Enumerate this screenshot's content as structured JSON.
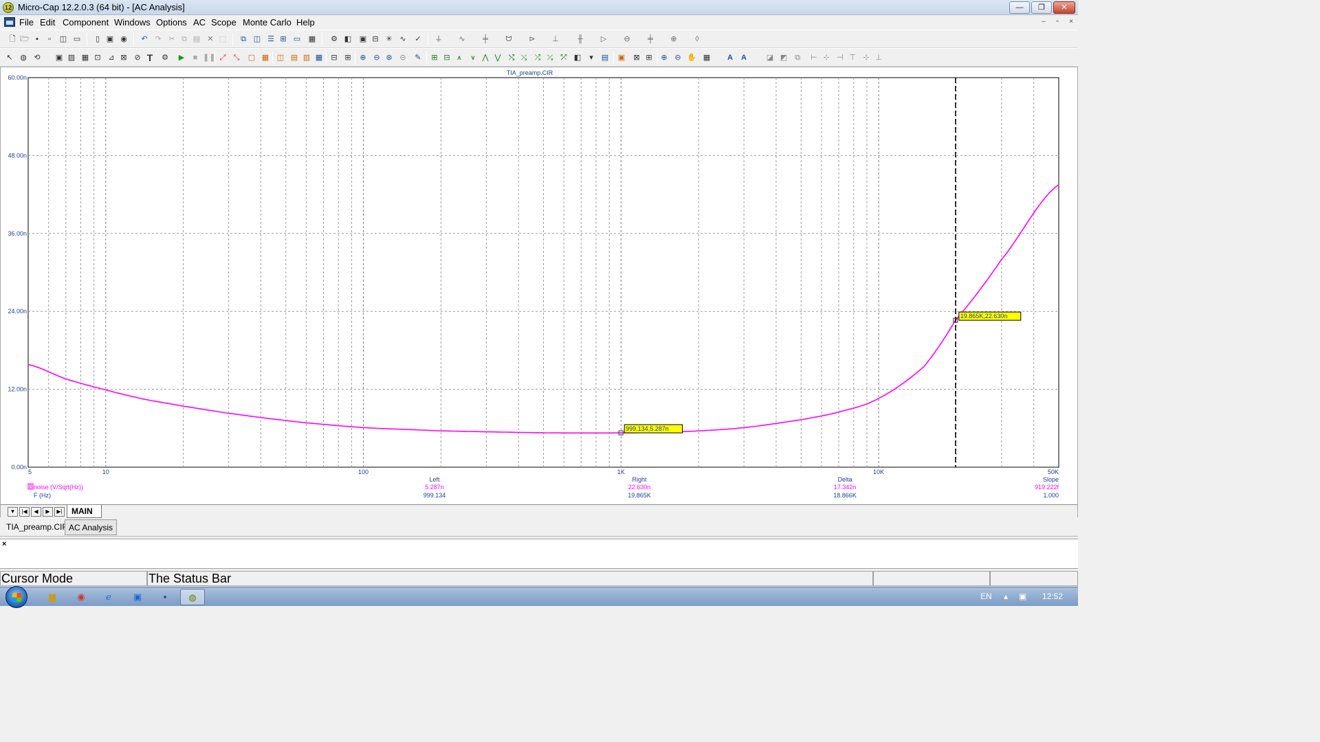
{
  "window": {
    "title": "Micro-Cap 12.2.0.3 (64 bit) - [AC Analysis]",
    "app_icon_label": "12",
    "minimize": "—",
    "restore": "❐",
    "close": "✕"
  },
  "menu": {
    "items": [
      "File",
      "Edit",
      "Component",
      "Windows",
      "Options",
      "AC",
      "Scope",
      "Monte Carlo",
      "Help"
    ],
    "mdi_minimize": "–",
    "mdi_restore": "▫",
    "mdi_close": "×"
  },
  "chart_data": {
    "type": "line",
    "title": "TIA_preamp.CIR",
    "x_scale": "log",
    "xlim": [
      5,
      50000
    ],
    "ylim": [
      0,
      60
    ],
    "x_tick_labels": [
      "5",
      "10",
      "100",
      "1K",
      "10K",
      "50K"
    ],
    "x_tick_values": [
      5,
      10,
      100,
      1000,
      10000,
      50000
    ],
    "y_tick_labels": [
      "0.00n",
      "12.00n",
      "24.00n",
      "36.00n",
      "48.00n",
      "60.00n"
    ],
    "y_tick_values": [
      0,
      12,
      24,
      36,
      48,
      60
    ],
    "grid": "on",
    "series": [
      {
        "name": "noise (V/Sqrt(Hz))",
        "color": "#ff00ff",
        "x": [
          5,
          7,
          10,
          14,
          20,
          30,
          50,
          70,
          100,
          150,
          200,
          300,
          500,
          700,
          1000,
          1500,
          2000,
          3000,
          5000,
          7000,
          10000,
          15000,
          19865,
          30000,
          50000
        ],
        "y": [
          15.8,
          13.6,
          11.9,
          10.5,
          9.4,
          8.3,
          7.2,
          6.6,
          6.1,
          5.8,
          5.6,
          5.45,
          5.3,
          5.27,
          5.287,
          5.4,
          5.6,
          6.1,
          7.3,
          8.5,
          10.6,
          15.5,
          22.63,
          32.0,
          43.5
        ]
      }
    ],
    "cursors": [
      {
        "x": 999.134,
        "y": 5.287,
        "label": "999.134,5.287n",
        "line": "none"
      },
      {
        "x": 19865,
        "y": 22.63,
        "label": "19.865K,22.630n",
        "line": "dashed"
      }
    ],
    "readout": {
      "trace_label": "noise (V/Sqrt(Hz))",
      "x_expr_label": "F (Hz)",
      "headers": [
        "Left",
        "Right",
        "Delta",
        "Slope"
      ],
      "row1": [
        "5.287n",
        "22.630n",
        "17.342n",
        "919.222f"
      ],
      "row2": [
        "999.134",
        "19.865K",
        "18.866K",
        "1.000"
      ]
    }
  },
  "tabs": {
    "nav_buttons": [
      "▼",
      "|◀",
      "◀",
      "▶",
      "▶|"
    ],
    "main_tab": "MAIN"
  },
  "doc_tabs": [
    "TIA_preamp.CIR",
    "AC Analysis"
  ],
  "output": {
    "close": "×"
  },
  "status": {
    "left": "Cursor Mode",
    "right": "The Status Bar"
  },
  "taskbar": {
    "language": "EN",
    "clock": "12:52"
  }
}
